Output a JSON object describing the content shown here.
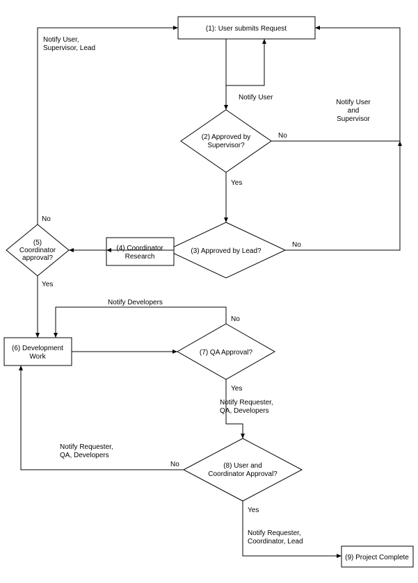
{
  "nodes": {
    "n1": "(1): User submits Request",
    "n2_l1": "(2) Approved by",
    "n2_l2": "Supervisor?",
    "n3": "(3) Approved by Lead?",
    "n4_l1": "(4) Coordinator",
    "n4_l2": "Research",
    "n5_l1": "(5)",
    "n5_l2": "Coordinator",
    "n5_l3": "approval?",
    "n6_l1": "(6) Development",
    "n6_l2": "Work",
    "n7": "(7) QA Approval?",
    "n8_l1": "(8) User and",
    "n8_l2": "Coordinator Approval?",
    "n9": "(9) Project Complete"
  },
  "labels": {
    "yes": "Yes",
    "no": "No",
    "notify_user": "Notify User",
    "notify_user_supervisor_l1": "Notify User",
    "notify_user_supervisor_l2": "and",
    "notify_user_supervisor_l3": "Supervisor",
    "notify_usl_l1": "Notify User,",
    "notify_usl_l2": "Supervisor, Lead",
    "notify_dev": "Notify Developers",
    "notify_rqd_l1": "Notify Requester,",
    "notify_rqd_l2": "QA, Developers",
    "notify_rcl_l1": "Notify Requester,",
    "notify_rcl_l2": "Coordinator, Lead"
  }
}
